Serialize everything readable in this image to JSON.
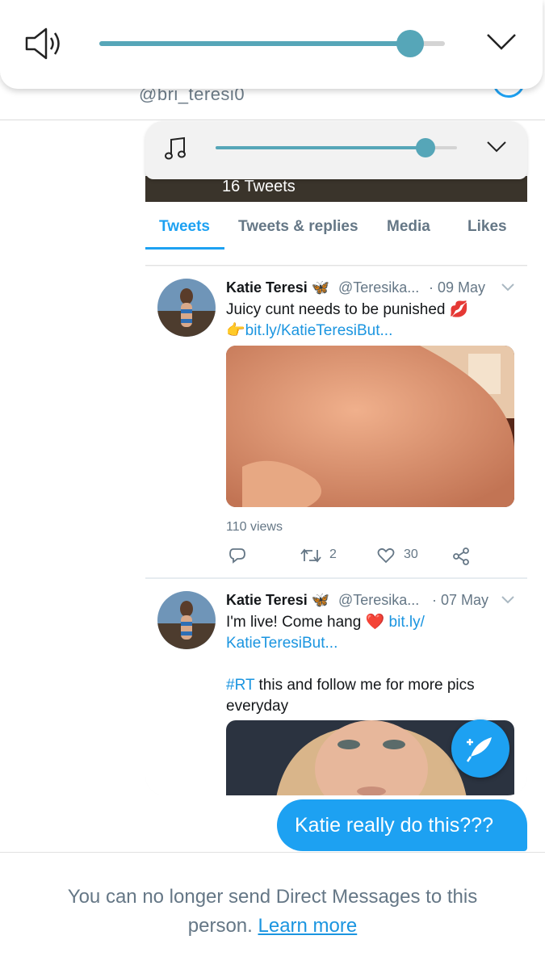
{
  "volume_overlay": {
    "icon": "speaker-icon",
    "level": 0.9,
    "accent": "#56a6b8",
    "collapse_icon": "chevron-down-icon"
  },
  "profile_header": {
    "handle": "@bri_teresi0"
  },
  "shared_screenshot": {
    "media_volume": {
      "icon": "music-note-icon",
      "level": 0.87,
      "collapse_icon": "chevron-down-icon"
    },
    "tweet_count": "16 Tweets",
    "tabs": [
      {
        "label": "Tweets",
        "active": true
      },
      {
        "label": "Tweets & replies",
        "active": false
      },
      {
        "label": "Media",
        "active": false
      },
      {
        "label": "Likes",
        "active": false
      }
    ],
    "tweets": [
      {
        "name": "Katie Teresi 🦋",
        "handle": "@Teresika...",
        "date": "· 09 May",
        "text": "Juicy cunt needs to be punished 💋",
        "link": "👉bit.ly/KatieTeresiBut...",
        "views": "110 views",
        "retweets": "2",
        "likes": "30"
      },
      {
        "name": "Katie Teresi 🦋",
        "handle": "@Teresika...",
        "date": "· 07 May",
        "text": "I'm live! Come hang ❤️",
        "link_part1": "bit.ly/",
        "link_part2": "KatieTeresiBut...",
        "hashtag": "#RT",
        "text2_a": " this and follow me for more pics",
        "text2_b": "everyday"
      }
    ]
  },
  "message": {
    "text": "Katie really do this???"
  },
  "footer": {
    "line1": "You can no longer send Direct Messages to this",
    "line2": "person.",
    "link": "Learn more"
  },
  "colors": {
    "twitter_blue": "#1da1f2",
    "gray_text": "#657786"
  }
}
